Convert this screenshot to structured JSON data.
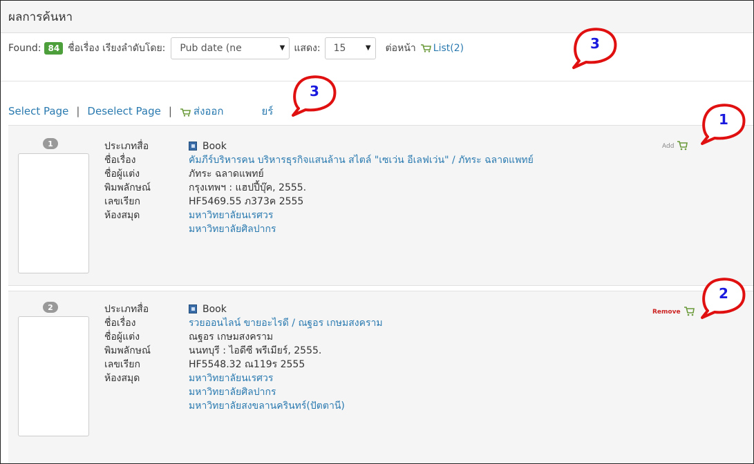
{
  "header": {
    "title": "ผลการค้นหา"
  },
  "toolbar": {
    "found_label": "Found:",
    "found_count": "84",
    "sort_label": "ชื่อเรื่อง เรียงลำดับโดย:",
    "sort_value": "Pub date (ne",
    "show_label": "แสดง:",
    "per_page_value": "15",
    "per_page_suffix": "ต่อหน้า",
    "list_link": "List(2)"
  },
  "selection": {
    "select_page": "Select Page",
    "deselect_page": "Deselect Page",
    "export": "ส่งออก",
    "export_tail": "ยร์"
  },
  "records": [
    {
      "number": "1",
      "type_key": "ประเภทสื่อ",
      "type_value": "Book",
      "title_key": "ชื่อเรื่อง",
      "title_value": "คัมภีร์บริหารคน บริหารธุรกิจแสนล้าน สไตล์ \"เซเว่น อีเลฟเว่น\" / ภัทระ ฉลาดแพทย์",
      "author_key": "ชื่อผู้แต่ง",
      "author_value": "ภัทระ ฉลาดแพทย์",
      "pub_key": "พิมพลักษณ์",
      "pub_value": "กรุงเทพฯ : แฮปปี้บุ๊ค, 2555.",
      "call_key": "เลขเรียก",
      "call_value": "HF5469.55 ภ373ค 2555",
      "lib_key": "ห้องสมุด",
      "libraries": [
        "มหาวิทยาลัยนเรศวร",
        "มหาวิทยาลัยศิลปากร"
      ],
      "action": "Add",
      "action_color": "#888888"
    },
    {
      "number": "2",
      "type_key": "ประเภทสื่อ",
      "type_value": "Book",
      "title_key": "ชื่อเรื่อง",
      "title_value": "รวยออนไลน์ ขายอะไรดี / ณฐอร เกษมสงคราม",
      "author_key": "ชื่อผู้แต่ง",
      "author_value": "ณฐอร เกษมสงคราม",
      "pub_key": "พิมพลักษณ์",
      "pub_value": "นนทบุรี : ไอดีซี พรีเมียร์, 2555.",
      "call_key": "เลขเรียก",
      "call_value": "HF5548.32 ณ119ร 2555",
      "lib_key": "ห้องสมุด",
      "libraries": [
        "มหาวิทยาลัยนเรศวร",
        "มหาวิทยาลัยศิลปากร",
        "มหาวิทยาลัยสงขลานครินทร์(ปัตตานี)"
      ],
      "action": "Remove",
      "action_color": "#cc2222"
    }
  ],
  "callouts": [
    "1",
    "2",
    "3",
    "3"
  ],
  "colors": {
    "accent": "#2a7ab0",
    "callout_red": "#e01010",
    "callout_num": "#1a1adf",
    "badge_green": "#4c9f3a"
  },
  "icons": {
    "cart": "cart-icon",
    "book": "book-icon"
  }
}
